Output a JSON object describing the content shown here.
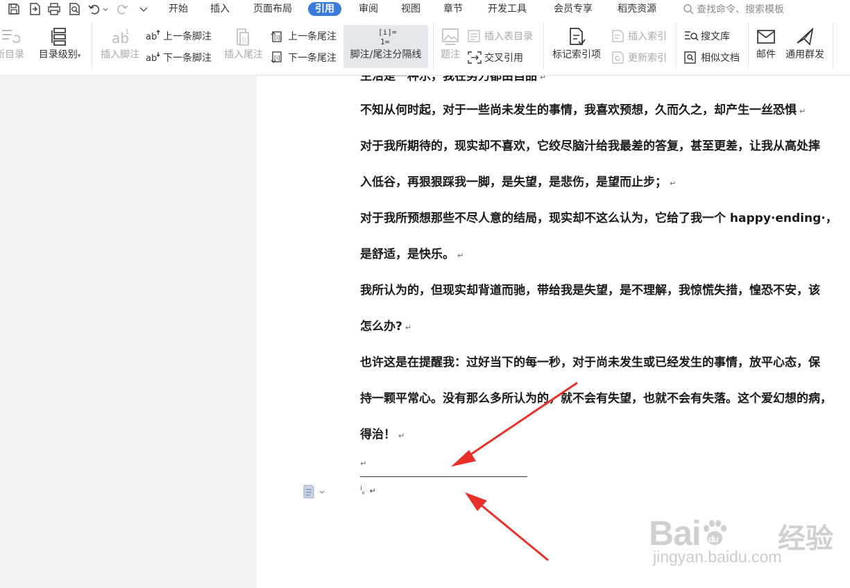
{
  "menu": {
    "tabs": [
      {
        "label": "开始"
      },
      {
        "label": "插入"
      },
      {
        "label": "页面布局"
      },
      {
        "label": "引用"
      },
      {
        "label": "审阅"
      },
      {
        "label": "视图"
      },
      {
        "label": "章节"
      },
      {
        "label": "开发工具"
      },
      {
        "label": "会员专享"
      },
      {
        "label": "稻壳资源"
      }
    ],
    "active_tab": "引用",
    "search_placeholder": "查找命令、搜索模板"
  },
  "ribbon": {
    "update_toc": "新目录",
    "toc_level": "目录级别",
    "insert_footnote": "插入脚注",
    "prev_footnote": "上一条脚注",
    "next_footnote": "下一条脚注",
    "insert_endnote": "插入尾注",
    "prev_endnote": "上一条尾注",
    "next_endnote": "下一条尾注",
    "separator_line": "脚注/尾注分隔线",
    "caption": "题注",
    "insert_table_of_figures": "插入表目录",
    "cross_reference": "交叉引用",
    "mark_index_entry": "标记索引项",
    "insert_index": "插入索引",
    "update_index": "更新索引",
    "search_library": "搜文库",
    "similar_docs": "相似文档",
    "mail": "邮件",
    "mass_mail": "通用群发"
  },
  "document": {
    "paragraphs": [
      "生活是一种乐，我在努力都由自品",
      "不知从何时起，对于一些尚未发生的事情，我喜欢预想，久而久之，却产生一丝恐惧",
      "对于我所期待的，现实却不喜欢，它绞尽脑汁给我最差的答复，甚至更差，让我从高处摔",
      "入低谷，再狠狠踩我一脚，是失望，是悲伤，是望而止步；",
      "对于我所预想那些不尽人意的结局，现实却不这么认为，它给了我一个 happy·ending·，",
      "是舒适，是快乐。",
      "我所认为的，但现实却背道而驰，带给我是失望，是不理解，我惊慌失措，惶恐不安，该",
      "怎么办?",
      "也许这是在提醒我：过好当下的每一秒，对于尚未发生或已经发生的事情，放平心态，保",
      "持一颗平常心。没有那么多所认为的，就不会有失望，也就不会有失落。这个爱幻想的病，",
      "得治！"
    ],
    "paragraph_mark": "↵",
    "footnote_marker": "i",
    "footnote_text": "。↵"
  },
  "watermark": {
    "brand": "Bai",
    "brand_paw_text": "du",
    "brand_cn": "经验",
    "url": "jingyan.baidu.com"
  },
  "colors": {
    "accent": "#3a7bdc",
    "arrow": "#e8302a"
  }
}
